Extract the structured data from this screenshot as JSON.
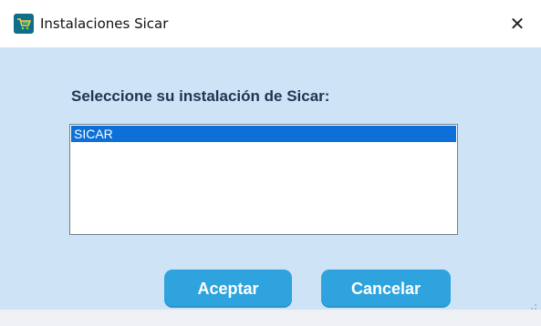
{
  "window": {
    "title": "Instalaciones Sicar",
    "close_glyph": "✕",
    "app_icon": "sicar-cart-icon"
  },
  "dialog": {
    "prompt": "Seleccione su instalación de Sicar:",
    "list": {
      "items": [
        {
          "label": "SICAR",
          "selected": true
        }
      ]
    },
    "buttons": {
      "accept_label": "Aceptar",
      "cancel_label": "Cancelar"
    }
  },
  "colors": {
    "client_bg": "#cfe3f7",
    "button_bg": "#2ea3dd",
    "selection_bg": "#0c70d8"
  }
}
